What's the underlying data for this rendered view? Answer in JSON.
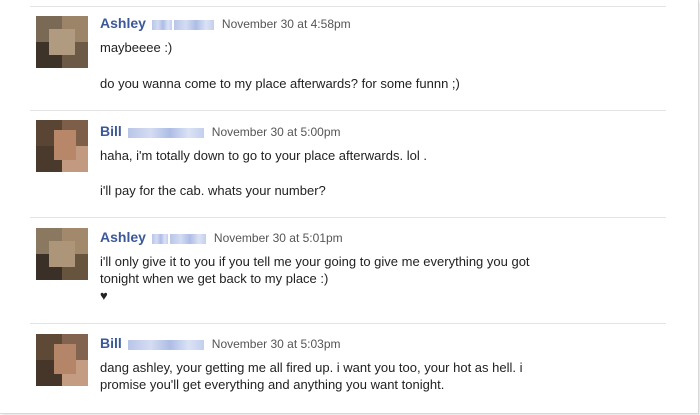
{
  "messages": [
    {
      "author": "Ashley",
      "timestamp": "November 30 at 4:58pm",
      "lines": [
        "maybeeee :)",
        "do you wanna come to my place afterwards? for some funnn ;)"
      ]
    },
    {
      "author": "Bill",
      "timestamp": "November 30 at 5:00pm",
      "lines": [
        "haha, i'm totally down to go to your place afterwards. lol .",
        "i'll pay for the cab. whats your number?"
      ]
    },
    {
      "author": "Ashley",
      "timestamp": "November 30 at 5:01pm",
      "lines": [
        "i'll only give it to you if you tell me your going to give me everything you got",
        "tonight when we get back to my place :)",
        "♥"
      ]
    },
    {
      "author": "Bill",
      "timestamp": "November 30 at 5:03pm",
      "lines": [
        "dang ashley, your getting me all fired up. i want you too, your hot as hell. i",
        "promise you'll get everything and anything you want tonight."
      ]
    }
  ],
  "colors": {
    "author_link": "#3b5998",
    "divider": "#e3e3e3",
    "redaction": "#b9c6e8"
  }
}
